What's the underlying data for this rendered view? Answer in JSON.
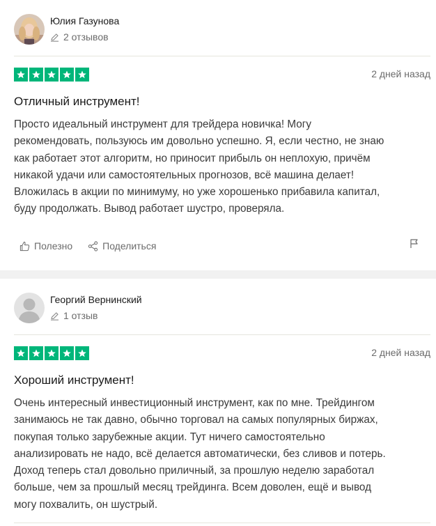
{
  "reviews": [
    {
      "author": "Юлия Газунова",
      "review_count": "2 отзывов",
      "avatar": "user-photo",
      "rating": 5,
      "date": "2 дней назад",
      "title": "Отличный инструмент!",
      "body_lines": [
        "Просто идеальный инструмент для трейдера новичка! Могу",
        "рекомендовать, пользуюсь им довольно успешно. Я, если честно, не знаю",
        "как работает этот алгоритм, но приносит прибыль он неплохую, причём",
        "никакой удачи или самостоятельных прогнозов, всё машина делает!",
        "Вложилась в акции по минимуму, но уже хорошенько прибавила капитал,",
        "буду продолжать. Вывод работает шустро, проверяла."
      ],
      "actions": {
        "useful": "Полезно",
        "share": "Поделиться"
      }
    },
    {
      "author": "Георгий Вернинский",
      "review_count": "1 отзыв",
      "avatar": "default-user-avatar",
      "rating": 5,
      "date": "2 дней назад",
      "title": "Хороший инструмент!",
      "body_lines": [
        "Очень интересный инвестиционный инструмент, как по мне. Трейдингом",
        "занимаюсь не так давно, обычно торговал на самых популярных биржах,",
        "покупая только зарубежные акции. Тут ничего самостоятельно",
        "анализировать не надо, всё делается автоматически, без сливов и потерь.",
        "Доход теперь стал довольно приличный, за прошлую неделю заработал",
        "больше, чем за прошлый месяц трейдинга. Всем доволен, ещё и вывод",
        "могу похвалить, он шустрый."
      ]
    }
  ],
  "colors": {
    "star_green": "#00b67a",
    "muted_text": "#6b6b6b",
    "divider": "#e5e5dd",
    "section_gap": "#f1f1f1"
  }
}
